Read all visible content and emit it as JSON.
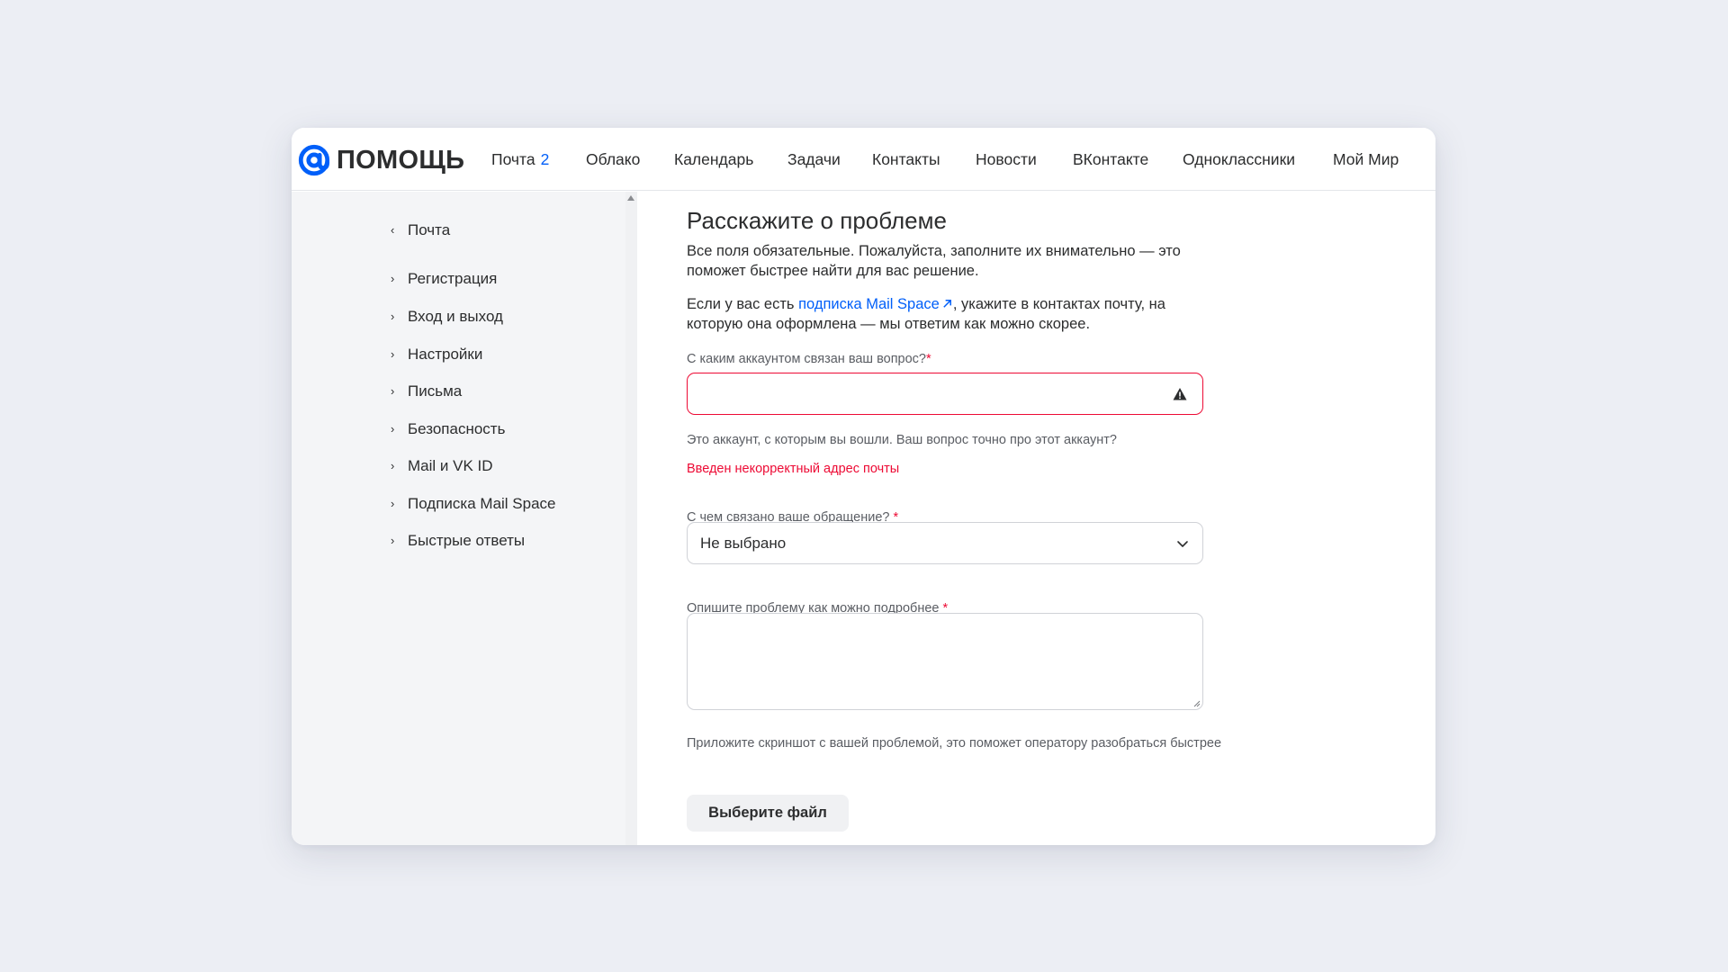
{
  "header": {
    "logo_text": "ПОМОЩЬ",
    "nav": [
      {
        "label": "Почта",
        "badge": "2"
      },
      {
        "label": "Облако"
      },
      {
        "label": "Календарь"
      },
      {
        "label": "Задачи"
      },
      {
        "label": "Контакты"
      },
      {
        "label": "Новости"
      },
      {
        "label": "ВКонтакте"
      },
      {
        "label": "Одноклассники"
      },
      {
        "label": "Мой Мир"
      }
    ]
  },
  "sidebar": {
    "back_label": "Почта",
    "items": [
      {
        "label": "Регистрация"
      },
      {
        "label": "Вход и выход"
      },
      {
        "label": "Настройки"
      },
      {
        "label": "Письма"
      },
      {
        "label": "Безопасность"
      },
      {
        "label": "Mail и VK ID"
      },
      {
        "label": "Подписка Mail Space"
      },
      {
        "label": "Быстрые ответы"
      }
    ]
  },
  "form": {
    "title": "Расскажите о проблеме",
    "intro_line1": "Все поля обязательные. Пожалуйста, заполните их внимательно — это",
    "intro_line2": "поможет быстрее найти для вас решение.",
    "sub_prefix": "Если у вас есть ",
    "sub_link": "подписка Mail Space",
    "sub_suffix": ", укажите в контактах почту, на",
    "sub_line2": "которую она оформлена — мы ответим как можно скорее.",
    "account": {
      "label": "С каким аккаунтом связан ваш вопрос?",
      "required_mark": "*",
      "value": "",
      "hint": "Это аккаунт, с которым вы вошли. Ваш вопрос точно про этот аккаунт?",
      "error": "Введен некорректный адрес почты"
    },
    "topic": {
      "label": "С чем связано ваше обращение?",
      "required_mark": "*",
      "selected": "Не выбрано"
    },
    "description": {
      "label": "Опишите проблему как можно подробнее",
      "required_mark": "*",
      "value": ""
    },
    "attach_hint": "Приложите скриншот с вашей проблемой, это поможет оператору разобраться быстрее",
    "file_button": "Выберите файл"
  },
  "colors": {
    "accent": "#005ff9",
    "error": "#ed0a34",
    "background": "#eceef4",
    "sidebar": "#f4f5f7"
  },
  "icons": {
    "logo": "at-sign-icon",
    "warning": "warning-triangle-icon",
    "dropdown": "chevron-down-icon",
    "external": "external-link-arrow-icon"
  }
}
